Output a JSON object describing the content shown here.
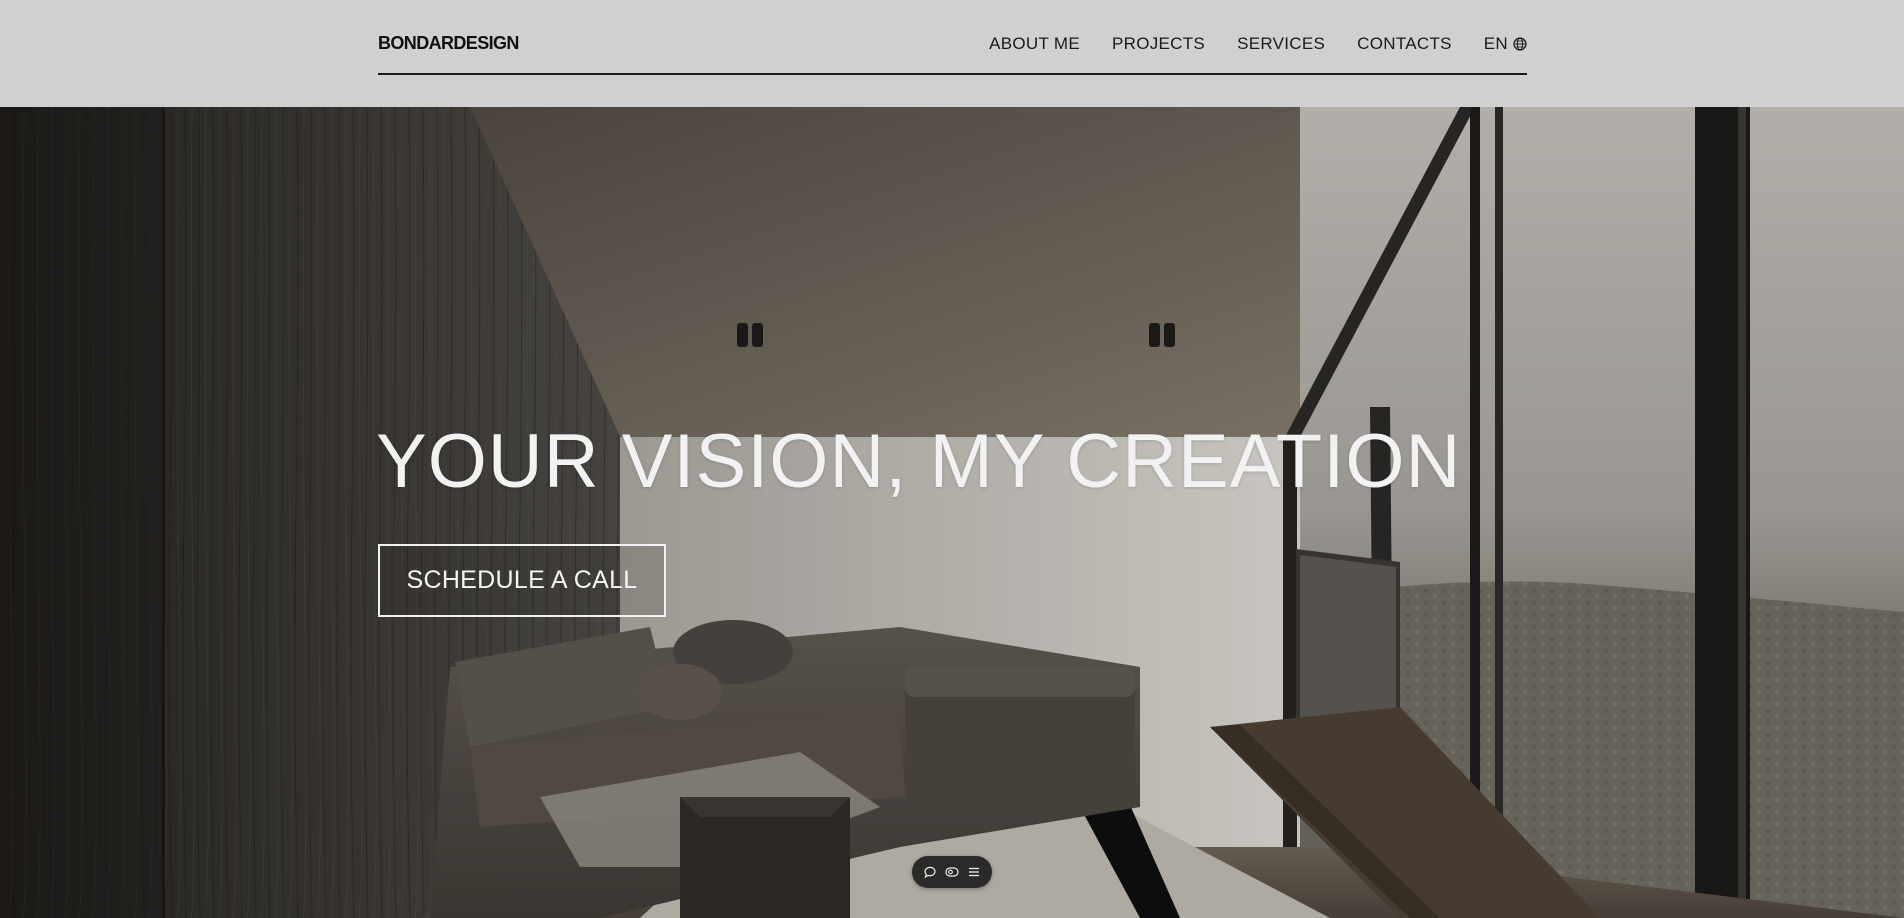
{
  "header": {
    "logo": "BONDARDESIGN",
    "nav": [
      {
        "label": "ABOUT ME"
      },
      {
        "label": "PROJECTS"
      },
      {
        "label": "SERVICES"
      },
      {
        "label": "CONTACTS"
      }
    ],
    "language": {
      "label": "EN",
      "icon": "globe-icon"
    }
  },
  "hero": {
    "title": "YOUR VISION, MY CREATION",
    "cta_label": "SCHEDULE A CALL",
    "background": "living-room-interior-photo"
  },
  "toolbar": {
    "icons": [
      "chat-bubble-icon",
      "eye-toggle-icon",
      "menu-lines-icon"
    ]
  },
  "colors": {
    "header_bg": "#d0d0d0",
    "text_dark": "#1a1a1a",
    "hero_text": "#f2f2f2",
    "toolbar_bg": "#2b2a29"
  }
}
